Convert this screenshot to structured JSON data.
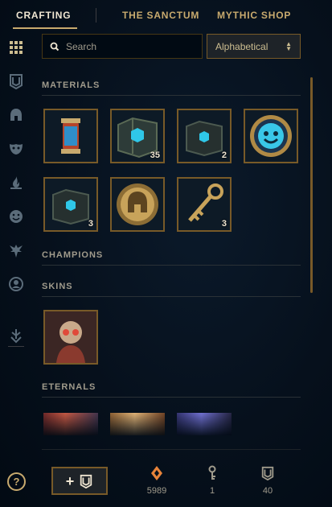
{
  "nav": {
    "tabs": [
      {
        "label": "CRAFTING",
        "active": true
      },
      {
        "label": "THE SANCTUM",
        "active": false
      },
      {
        "label": "MYTHIC SHOP",
        "active": false
      }
    ]
  },
  "sidebar": {
    "icons": [
      "grid-icon",
      "chest-icon",
      "helmet-icon",
      "mask-icon",
      "flame-icon",
      "emote-icon",
      "ward-icon",
      "profile-icon",
      "down-arrow-icon"
    ]
  },
  "search": {
    "placeholder": "Search",
    "value": ""
  },
  "sort": {
    "selected": "Alphabetical"
  },
  "sections": {
    "materials": {
      "title": "MATERIALS"
    },
    "champions": {
      "title": "CHAMPIONS"
    },
    "skins": {
      "title": "SKINS"
    },
    "eternals": {
      "title": "ETERNALS"
    }
  },
  "materials": [
    {
      "name": "lantern",
      "count": ""
    },
    {
      "name": "hextech-chest",
      "count": "35"
    },
    {
      "name": "masterwork-chest",
      "count": "2"
    },
    {
      "name": "emote-token",
      "count": ""
    },
    {
      "name": "hextech-chest-2",
      "count": "3"
    },
    {
      "name": "champion-shard-token",
      "count": ""
    },
    {
      "name": "hextech-key",
      "count": "3"
    }
  ],
  "currencies": [
    {
      "name": "orange-essence",
      "value": "5989"
    },
    {
      "name": "key-fragment",
      "value": "1"
    },
    {
      "name": "chest",
      "value": "40"
    }
  ],
  "colors": {
    "gold": "#c8aa6e",
    "gold_dark": "#785a28",
    "text": "#a09b8c",
    "bg": "#010a13"
  }
}
